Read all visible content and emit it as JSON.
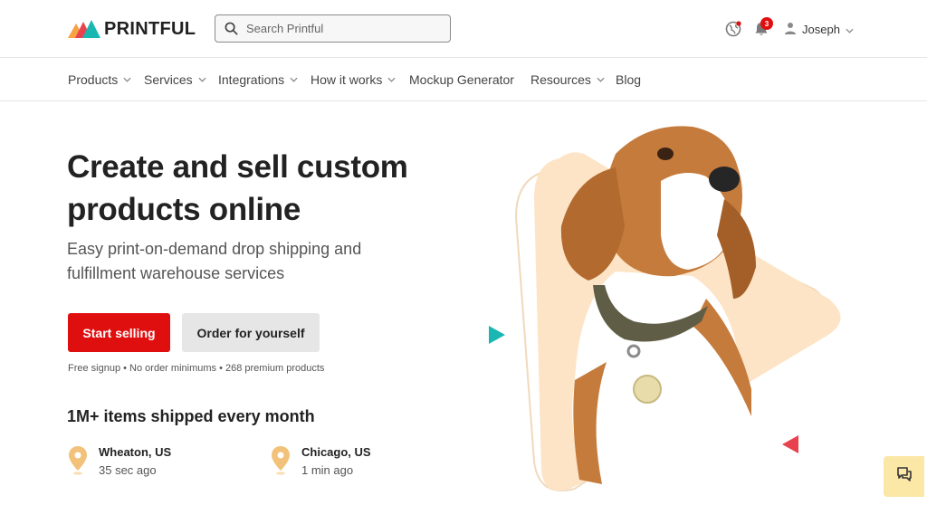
{
  "brand": {
    "name": "PRINTFUL"
  },
  "search": {
    "placeholder": "Search Printful"
  },
  "header": {
    "notification_count": "3",
    "user_name": "Joseph"
  },
  "nav": {
    "items": [
      {
        "label": "Products",
        "dropdown": true
      },
      {
        "label": "Services",
        "dropdown": true
      },
      {
        "label": "Integrations",
        "dropdown": true
      },
      {
        "label": "How it works",
        "dropdown": true
      },
      {
        "label": "Mockup Generator",
        "dropdown": false
      },
      {
        "label": "Resources",
        "dropdown": true
      },
      {
        "label": "Blog",
        "dropdown": false
      }
    ]
  },
  "hero": {
    "title_line1": "Create and sell custom",
    "title_line2": "products online",
    "subtitle_line1": "Easy print-on-demand drop shipping and",
    "subtitle_line2": "fulfillment warehouse services",
    "primary_cta": "Start selling",
    "secondary_cta": "Order for yourself",
    "meta": "Free signup • No order minimums • 268 premium products"
  },
  "stats": {
    "headline": "1M+ items shipped every month",
    "locations": [
      {
        "city": "Wheaton, US",
        "ago": "35 sec ago"
      },
      {
        "city": "Chicago, US",
        "ago": "1 min ago"
      }
    ]
  },
  "colors": {
    "primary_red": "#e00f0f",
    "teal_accent": "#1ab7b2",
    "peach": "#fde4c6",
    "pin": "#f2c27a",
    "chat_bg": "#fbe7a6"
  },
  "icons": {
    "search": "search-icon",
    "globe": "globe-icon",
    "bell": "bell-icon",
    "user": "user-icon",
    "chevron": "chevron-down-icon",
    "pin": "location-pin-icon",
    "chat": "chat-icon"
  }
}
